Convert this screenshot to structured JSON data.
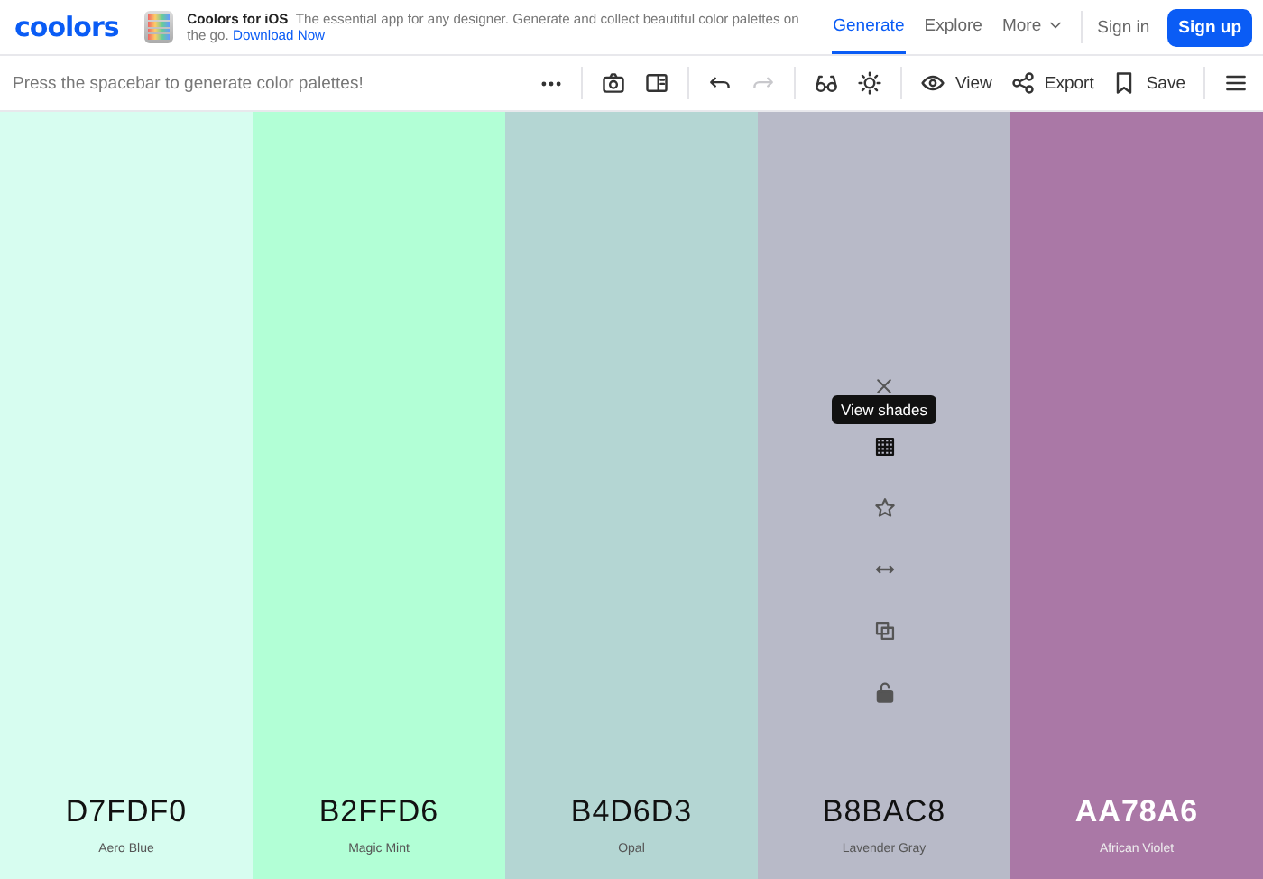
{
  "header": {
    "logo": "coolors",
    "promo": {
      "title": "Coolors for iOS",
      "text": "The essential app for any designer. Generate and collect beautiful color palettes on the go.",
      "link": "Download Now"
    },
    "nav": [
      {
        "label": "Generate",
        "selected": true
      },
      {
        "label": "Explore",
        "selected": false
      },
      {
        "label": "More",
        "selected": false,
        "kind": "menu"
      }
    ],
    "sign_in": "Sign in",
    "sign_up": "Sign up"
  },
  "toolbar": {
    "hint": "Press the spacebar to generate color palettes!",
    "redo_disabled": true,
    "view": "View",
    "export": "Export",
    "save": "Save"
  },
  "palette": [
    {
      "hex": "D7FDF0",
      "name": "Aero Blue",
      "color": "#d7fdf0",
      "light_text": false,
      "hovered": false
    },
    {
      "hex": "B2FFD6",
      "name": "Magic Mint",
      "color": "#b2ffd6",
      "light_text": false,
      "hovered": false
    },
    {
      "hex": "B4D6D3",
      "name": "Opal",
      "color": "#b4d6d3",
      "light_text": false,
      "hovered": false
    },
    {
      "hex": "B8BAC8",
      "name": "Lavender Gray",
      "color": "#b8bac8",
      "light_text": false,
      "hovered": true
    },
    {
      "hex": "AA78A6",
      "name": "African Violet",
      "color": "#aa78a6",
      "light_text": true,
      "hovered": false
    }
  ],
  "tooltip": "View shades"
}
